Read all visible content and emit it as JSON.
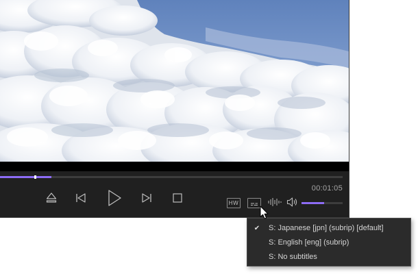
{
  "player": {
    "position_fraction": 0.15,
    "time_display": "00:01:05",
    "volume_fraction": 0.55,
    "hw_label": "HW",
    "accent_color": "#8d6cf5",
    "icons": {
      "eject": "eject-icon",
      "previous": "skip-previous-icon",
      "play": "play-icon",
      "next": "skip-next-icon",
      "stop": "stop-icon",
      "subtitles": "subtitles-icon",
      "audio_track": "audio-waveform-icon",
      "volume": "speaker-icon"
    }
  },
  "subtitle_menu": {
    "items": [
      {
        "label": "S: Japanese [jpn] (subrip) [default]",
        "checked": true
      },
      {
        "label": "S: English [eng] (subrip)",
        "checked": false
      },
      {
        "label": "S: No subtitles",
        "checked": false
      }
    ],
    "check_glyph": "✔"
  }
}
